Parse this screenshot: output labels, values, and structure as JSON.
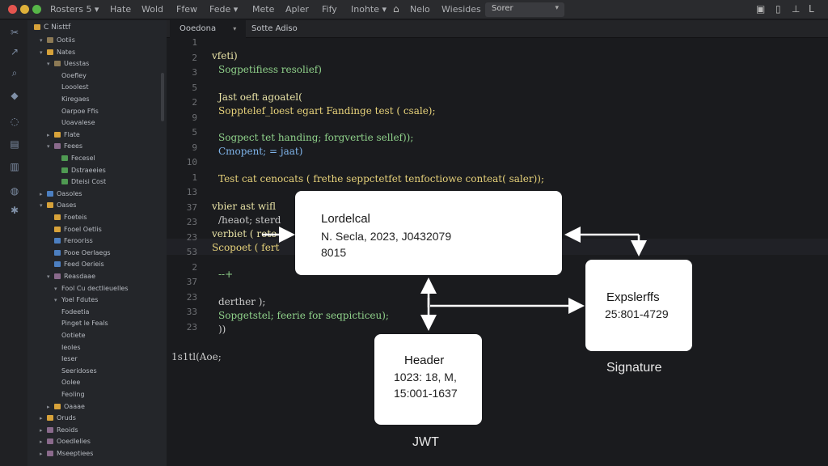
{
  "titlebar": {
    "menu": [
      "Rosters 5 ▾",
      "Hate",
      "Wold",
      "Ffew",
      "Fede ▾",
      "Mete",
      "Apler",
      "Fify",
      "Inohte ▾",
      "Nelo",
      "Wiesides"
    ],
    "search_label": "Sorer",
    "search_chevron": "▾"
  },
  "sidebar": {
    "header": "C Nisttf",
    "items": [
      {
        "label": "Ootiis",
        "depth": 1,
        "chev": "▾",
        "color": "#8d7a55"
      },
      {
        "label": "Nates",
        "depth": 1,
        "chev": "▾",
        "color": "#d7a23a"
      },
      {
        "label": "Uesstas",
        "depth": 2,
        "chev": "▾",
        "color": "#8d7a55"
      },
      {
        "label": "Ooefley",
        "depth": 3,
        "chev": "",
        "color": ""
      },
      {
        "label": "Looolest",
        "depth": 3,
        "chev": "",
        "color": ""
      },
      {
        "label": "Kiregaes",
        "depth": 3,
        "chev": "",
        "color": ""
      },
      {
        "label": "Oarpoe Ffis",
        "depth": 3,
        "chev": "",
        "color": ""
      },
      {
        "label": "Uoavalese",
        "depth": 3,
        "chev": "",
        "color": ""
      },
      {
        "label": "Flate",
        "depth": 2,
        "chev": "▸",
        "color": "#d7a23a"
      },
      {
        "label": "Feees",
        "depth": 2,
        "chev": "▾",
        "color": "#8a6a8c"
      },
      {
        "label": "Fecesel",
        "depth": 3,
        "chev": "",
        "color": "#4f9a52"
      },
      {
        "label": "Dstraeeies",
        "depth": 3,
        "chev": "",
        "color": "#4f9a52"
      },
      {
        "label": "Dteisi Cost",
        "depth": 3,
        "chev": "",
        "color": "#4f9a52"
      },
      {
        "label": "Oasoles",
        "depth": 1,
        "chev": "▸",
        "color": "#4c7fc1"
      },
      {
        "label": "Oases",
        "depth": 1,
        "chev": "▾",
        "color": "#d7a23a"
      },
      {
        "label": "Foeteis",
        "depth": 2,
        "chev": "",
        "color": "#d7a23a"
      },
      {
        "label": "Fooel Oetlis",
        "depth": 2,
        "chev": "",
        "color": "#d7a23a"
      },
      {
        "label": "Ferooriss",
        "depth": 2,
        "chev": "",
        "color": "#4c7fc1"
      },
      {
        "label": "Pooe Oerlaegs",
        "depth": 2,
        "chev": "",
        "color": "#4c7fc1"
      },
      {
        "label": "Feed Oerieis",
        "depth": 2,
        "chev": "",
        "color": "#4c7fc1"
      },
      {
        "label": "Reasdaae",
        "depth": 2,
        "chev": "▾",
        "color": "#8a6a8c"
      },
      {
        "label": "Fool Cu dectlieuelles",
        "depth": 3,
        "chev": "▾",
        "color": ""
      },
      {
        "label": "Yoel Fdutes",
        "depth": 3,
        "chev": "▾",
        "color": ""
      },
      {
        "label": "Fodeetia",
        "depth": 3,
        "chev": "",
        "color": ""
      },
      {
        "label": "Pinget le Feals",
        "depth": 3,
        "chev": "",
        "color": ""
      },
      {
        "label": "Ootiete",
        "depth": 3,
        "chev": "",
        "color": ""
      },
      {
        "label": "Ieoles",
        "depth": 3,
        "chev": "",
        "color": ""
      },
      {
        "label": "Ieser",
        "depth": 3,
        "chev": "",
        "color": ""
      },
      {
        "label": "Seeridoses",
        "depth": 3,
        "chev": "",
        "color": ""
      },
      {
        "label": "Oolee",
        "depth": 3,
        "chev": "",
        "color": ""
      },
      {
        "label": "Feoling",
        "depth": 3,
        "chev": "",
        "color": ""
      },
      {
        "label": "Oaaae",
        "depth": 2,
        "chev": "▸",
        "color": "#d7a23a"
      },
      {
        "label": "Oruds",
        "depth": 1,
        "chev": "▸",
        "color": "#d7a23a"
      },
      {
        "label": "Reoids",
        "depth": 1,
        "chev": "▸",
        "color": "#8a6a8c"
      },
      {
        "label": "Ooedlelies",
        "depth": 1,
        "chev": "▸",
        "color": "#8a6a8c"
      },
      {
        "label": "Mseeptiees",
        "depth": 1,
        "chev": "▸",
        "color": "#8a6a8c"
      }
    ]
  },
  "tabs": [
    {
      "label": "Ooedona",
      "chev": "▾"
    },
    {
      "label": "Sotte Adiso",
      "chev": ""
    }
  ],
  "editor": {
    "line_numbers": [
      "1",
      "2",
      "3",
      "5",
      "2",
      "9",
      "5",
      "9",
      "10",
      "1",
      "13",
      "37",
      "23",
      "23",
      "53",
      "2",
      "37",
      "23",
      "33",
      "23"
    ],
    "lines": [
      {
        "text": "vfeti)",
        "color": "#e9e3a6",
        "indent": 0
      },
      {
        "text": "Sogpetifiess resolief)",
        "color": "#8fd18a",
        "indent": 1
      },
      {
        "text": "",
        "color": "",
        "indent": 0
      },
      {
        "text": "Jast oeft agoatel(",
        "color": "#e9e3a6",
        "indent": 1
      },
      {
        "text": "Sopptelef_loest egart Fandinge test ( csale);",
        "color": "#e7d27a",
        "indent": 1
      },
      {
        "text": "",
        "color": "",
        "indent": 0
      },
      {
        "text": "Sogpect tet handing; forgvertie sellef));",
        "color": "#8fd18a",
        "indent": 1
      },
      {
        "text": "Cmopent; = jaat)",
        "color": "#7fb4ea",
        "indent": 1
      },
      {
        "text": "",
        "color": "",
        "indent": 0
      },
      {
        "text": "Test cat cenocats  ( frethe seppctetfet tenfoctiowe conteat( saler));",
        "color": "#e7d27a",
        "indent": 1
      },
      {
        "text": "",
        "color": "",
        "indent": 0
      },
      {
        "text": "vbier ast wifl",
        "color": "#e9e3a6",
        "indent": 0
      },
      {
        "text": "/heaot; sterd",
        "color": "#c9c9c9",
        "indent": 1
      },
      {
        "text": "verbiet ( rote",
        "color": "#e9e3a6",
        "indent": 0
      },
      {
        "text": "Scopoet ( fert",
        "color": "#e7d27a",
        "indent": 0
      },
      {
        "text": "",
        "color": "",
        "indent": 0
      },
      {
        "text": "--+",
        "color": "#8fd18a",
        "indent": 1
      },
      {
        "text": "",
        "color": "",
        "indent": 0
      },
      {
        "text": "derther  );",
        "color": "#c9c9c9",
        "indent": 1
      },
      {
        "text": "Sopgetstel; feerie for seqpicticeu);",
        "color": "#8fd18a",
        "indent": 1
      },
      {
        "text": "))",
        "color": "#c9c9c9",
        "indent": 1
      },
      {
        "text": "",
        "color": "",
        "indent": 0
      },
      {
        "text": "1s1tl(Aoe;",
        "color": "#c9c9c9",
        "indent": -1
      }
    ]
  },
  "diagram": {
    "main": {
      "title": "Lordelcal",
      "line1": "N. Secla, 2023, J0432079",
      "line2": "8015"
    },
    "signature": {
      "title": "Expslerffs",
      "line1": "25:801-4729",
      "caption": "Signature"
    },
    "header": {
      "title": "Header",
      "line1": "1023: 18, M,",
      "line2": "15:001-1637",
      "caption": "JWT"
    }
  }
}
